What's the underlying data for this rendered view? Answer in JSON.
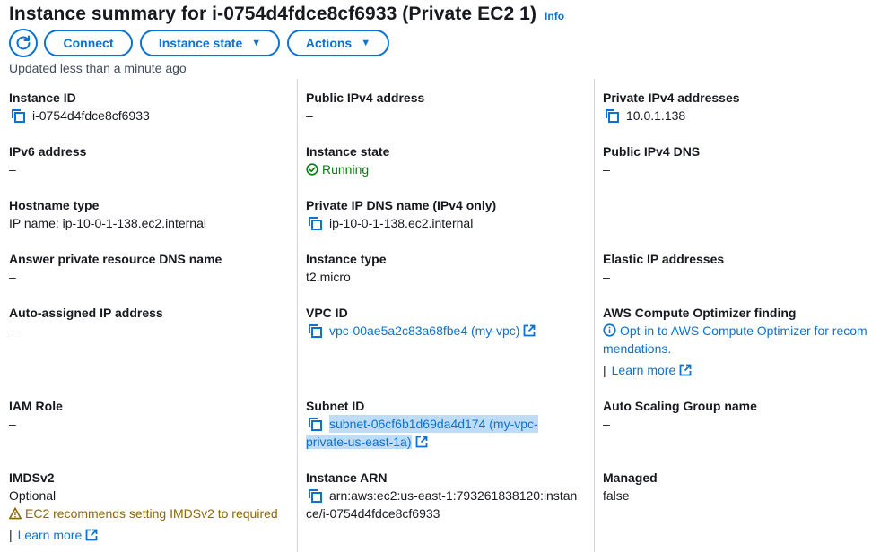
{
  "header": {
    "title": "Instance summary for i-0754d4fdce8cf6933 (Private EC2 1)",
    "info_label": "Info"
  },
  "toolbar": {
    "refresh_icon": "refresh-icon",
    "connect_label": "Connect",
    "instance_state_label": "Instance state",
    "actions_label": "Actions",
    "caret": "▼"
  },
  "updated_text": "Updated less than a minute ago",
  "col1": {
    "instance_id": {
      "label": "Instance ID",
      "value": "i-0754d4fdce8cf6933"
    },
    "ipv6": {
      "label": "IPv6 address",
      "value": "–"
    },
    "hostname_type": {
      "label": "Hostname type",
      "value": "IP name: ip-10-0-1-138.ec2.internal"
    },
    "answer_dns": {
      "label": "Answer private resource DNS name",
      "value": "–"
    },
    "auto_ip": {
      "label": "Auto-assigned IP address",
      "value": "–"
    },
    "iam_role": {
      "label": "IAM Role",
      "value": "–"
    },
    "imdsv2": {
      "label": "IMDSv2",
      "value": "Optional",
      "warning": "EC2 recommends setting IMDSv2 to required",
      "learn_more": "Learn more"
    }
  },
  "col2": {
    "public_ipv4": {
      "label": "Public IPv4 address",
      "value": "–"
    },
    "instance_state": {
      "label": "Instance state",
      "value": "Running"
    },
    "private_dns": {
      "label": "Private IP DNS name (IPv4 only)",
      "value": "ip-10-0-1-138.ec2.internal"
    },
    "instance_type": {
      "label": "Instance type",
      "value": "t2.micro"
    },
    "vpc_id": {
      "label": "VPC ID",
      "value": "vpc-00ae5a2c83a68fbe4 (my-vpc)"
    },
    "subnet_id": {
      "label": "Subnet ID",
      "value_line1": "subnet-06cf6b1d69da4d174 (my-vpc-",
      "value_line2": "private-us-east-1a)"
    },
    "instance_arn": {
      "label": "Instance ARN",
      "value_line1": "arn:aws:ec2:us-east-1:793261838120:instan",
      "value_line2": "ce/i-0754d4fdce8cf6933"
    }
  },
  "col3": {
    "private_ipv4": {
      "label": "Private IPv4 addresses",
      "value": "10.0.1.138"
    },
    "public_dns": {
      "label": "Public IPv4 DNS",
      "value": "–"
    },
    "elastic_ip": {
      "label": "Elastic IP addresses",
      "value": "–"
    },
    "optimizer": {
      "label": "AWS Compute Optimizer finding",
      "value_line1": "Opt-in to AWS Compute Optimizer for recom",
      "value_line2": "mendations.",
      "learn_more": "Learn more"
    },
    "asg": {
      "label": "Auto Scaling Group name",
      "value": "–"
    },
    "managed": {
      "label": "Managed",
      "value": "false"
    }
  },
  "colors": {
    "link": "#0972d3",
    "success": "#037f0c",
    "warning": "#8d6605",
    "divider": "#d1d5db"
  }
}
